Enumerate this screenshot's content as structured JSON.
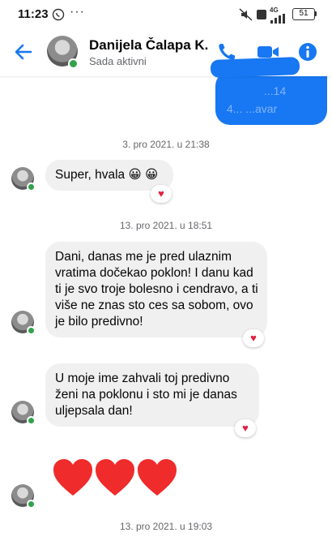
{
  "status_bar": {
    "time": "11:23",
    "network": "4G",
    "battery": "51"
  },
  "header": {
    "contact_name": "Danijela Čalapa K...",
    "presence": "Sada aktivni"
  },
  "outgoing_partial": {
    "line1": "...14",
    "line2": "4... ...avar"
  },
  "messages": [
    {
      "date": "3. pro 2021. u 21:38"
    },
    {
      "text": "Super, hvala 😀 😀",
      "reaction": "♥"
    },
    {
      "date": "13. pro 2021. u 18:51"
    },
    {
      "text": "Dani, danas me je pred ulaznim vratima dočekao poklon! I danu kad ti je svo troje bolesno i cendravo, a ti više ne znas sto ces sa sobom, ovo je bilo predivno!",
      "reaction": "♥"
    },
    {
      "text": "U moje ime zahvali toj predivno ženi na poklonu i sto mi je danas uljepsala dan!",
      "reaction": "♥"
    },
    {
      "hearts": "❤❤❤"
    },
    {
      "date": "13. pro 2021. u 19:03"
    }
  ],
  "icons": {
    "back": "arrow-left-icon",
    "call": "phone-icon",
    "video": "video-camera-icon",
    "info": "info-icon"
  },
  "colors": {
    "accent": "#1877f2",
    "online": "#31a24c",
    "bubble": "#f0f0f0",
    "heart": "#e41e3f"
  }
}
